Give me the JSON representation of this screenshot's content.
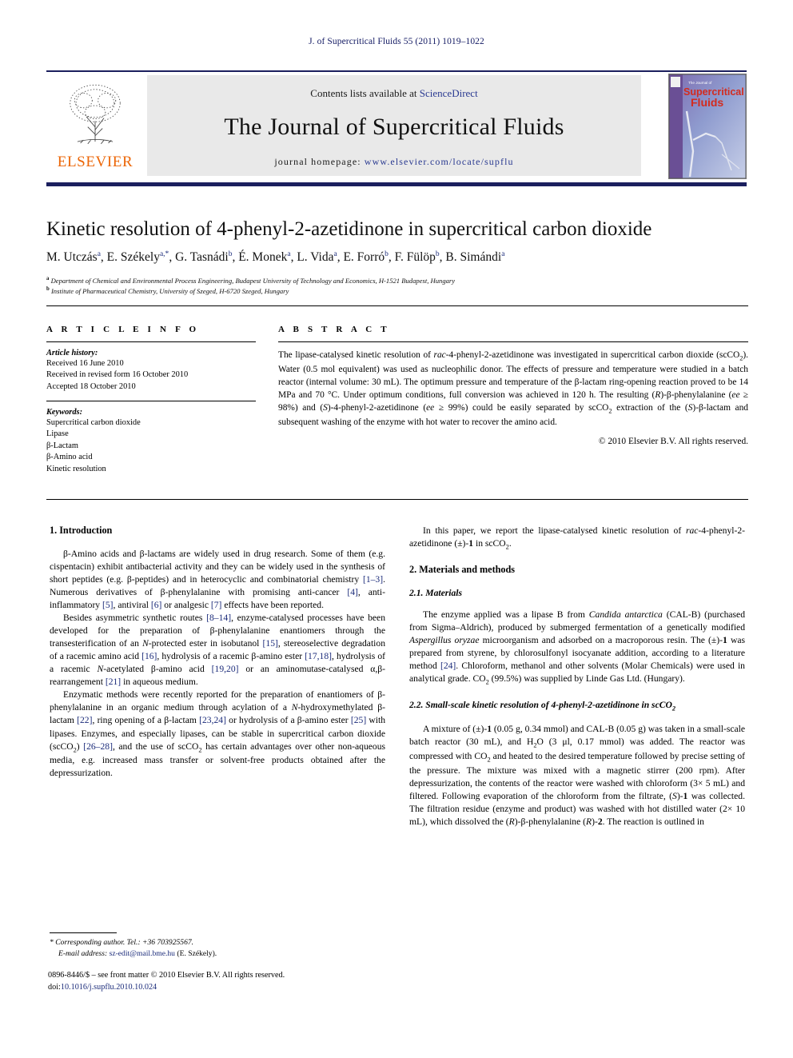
{
  "running_head": "J. of Supercritical Fluids 55 (2011) 1019–1022",
  "banner": {
    "publisher": "ELSEVIER",
    "contents_prefix": "Contents lists available at ",
    "contents_link": "ScienceDirect",
    "journal_title": "The Journal of Supercritical Fluids",
    "homepage_prefix": "journal homepage: ",
    "homepage_url": "www.elsevier.com/locate/supflu",
    "cover_line1": "The Journal of",
    "cover_line2": "Supercritical",
    "cover_line3": "Fluids",
    "accent_orange": "#ec6607",
    "accent_blue": "#2a3a91",
    "rule_navy": "#1b1f5e"
  },
  "article": {
    "title": "Kinetic resolution of 4-phenyl-2-azetidinone in supercritical carbon dioxide",
    "authors_html": "M. Utczás<sup>a</sup>, E. Székely<sup>a,*</sup>, G. Tasnádi<sup>b</sup>, É. Monek<sup>a</sup>, L. Vida<sup>a</sup>, E. Forró<sup>b</sup>, F. Fülöp<sup>b</sup>, B. Simándi<sup>a</sup>",
    "affiliation_a": "Department of Chemical and Environmental Process Engineering, Budapest University of Technology and Economics, H-1521 Budapest, Hungary",
    "affiliation_b": "Institute of Pharmaceutical Chemistry, University of Szeged, H-6720 Szeged, Hungary"
  },
  "info": {
    "heading": "A R T I C L E    I N F O",
    "history_label": "Article history:",
    "history": [
      "Received 16 June 2010",
      "Received in revised form 16 October 2010",
      "Accepted 18 October 2010"
    ],
    "keywords_label": "Keywords:",
    "keywords": [
      "Supercritical carbon dioxide",
      "Lipase",
      "β-Lactam",
      "β-Amino acid",
      "Kinetic resolution"
    ]
  },
  "abstract": {
    "heading": "A B S T R A C T",
    "text_html": "The lipase-catalysed kinetic resolution of <i>rac</i>-4-phenyl-2-azetidinone was investigated in supercritical carbon dioxide (scCO<sub>2</sub>). Water (0.5 mol equivalent) was used as nucleophilic donor. The effects of pressure and temperature were studied in a batch reactor (internal volume: 30 mL). The optimum pressure and temperature of the β-lactam ring-opening reaction proved to be 14 MPa and 70 °C. Under optimum conditions, full conversion was achieved in 120 h. The resulting (<i>R</i>)-β-phenylalanine (<i>ee</i> ≥ 98%) and (<i>S</i>)-4-phenyl-2-azetidinone (<i>ee</i> ≥ 99%) could be easily separated by scCO<sub>2</sub> extraction of the (<i>S</i>)-β-lactam and subsequent washing of the enzyme with hot water to recover the amino acid.",
    "copyright": "© 2010 Elsevier B.V. All rights reserved."
  },
  "body": {
    "left": {
      "section1_heading": "1.  Introduction",
      "p1_html": "β-Amino acids and β-lactams are widely used in drug research. Some of them (e.g. cispentacin) exhibit antibacterial activity and they can be widely used in the synthesis of short peptides (e.g. β-peptides) and in heterocyclic and combinatorial chemistry <span class=\"ref\">[1–3]</span>. Numerous derivatives of β-phenylalanine with promising anti-cancer <span class=\"ref\">[4]</span>, anti-inflammatory <span class=\"ref\">[5]</span>, antiviral <span class=\"ref\">[6]</span> or analgesic <span class=\"ref\">[7]</span> effects have been reported.",
      "p2_html": "Besides asymmetric synthetic routes <span class=\"ref\">[8–14]</span>, enzyme-catalysed processes have been developed for the preparation of β-phenylalanine enantiomers through the transesterification of an <i>N</i>-protected ester in isobutanol <span class=\"ref\">[15]</span>, stereoselective degradation of a racemic amino acid <span class=\"ref\">[16]</span>, hydrolysis of a racemic β-amino ester <span class=\"ref\">[17,18]</span>, hydrolysis of a racemic <i>N</i>-acetylated β-amino acid <span class=\"ref\">[19,20]</span> or an aminomutase-catalysed α,β-rearrangement <span class=\"ref\">[21]</span> in aqueous medium.",
      "p3_html": "Enzymatic methods were recently reported for the preparation of enantiomers of β-phenylalanine in an organic medium through acylation of a <i>N</i>-hydroxymethylated β-lactam <span class=\"ref\">[22]</span>, ring opening of a β-lactam <span class=\"ref\">[23,24]</span> or hydrolysis of a β-amino ester <span class=\"ref\">[25]</span> with lipases. Enzymes, and especially lipases, can be stable in supercritical carbon dioxide (scCO<sub>2</sub>) <span class=\"ref\">[26–28]</span>, and the use of scCO<sub>2</sub> has certain advantages over other non-aqueous media, e.g. increased mass transfer or solvent-free products obtained after the depressurization."
    },
    "right": {
      "p1_html": "In this paper, we report the lipase-catalysed kinetic resolution of <i>rac</i>-4-phenyl-2-azetidinone (±)-<b>1</b> in scCO<sub>2</sub>.",
      "section2_heading": "2.  Materials and methods",
      "subsection21_heading": "2.1.  Materials",
      "p2_html": "The enzyme applied was a lipase B from <i>Candida antarctica</i> (CAL-B) (purchased from Sigma–Aldrich), produced by submerged fermentation of a genetically modified <i>Aspergillus oryzae</i> microorganism and adsorbed on a macroporous resin. The (±)-<b>1</b> was prepared from styrene, by chlorosulfonyl isocyanate addition, according to a literature method <span class=\"ref\">[24]</span>. Chloroform, methanol and other solvents (Molar Chemicals) were used in analytical grade. CO<sub>2</sub> (99.5%) was supplied by Linde Gas Ltd. (Hungary).",
      "subsection22_heading_html": "2.2.  Small-scale kinetic resolution of 4-phenyl-2-azetidinone in scCO<sub>2</sub>",
      "p3_html": "A mixture of (±)-<b>1</b> (0.05 g, 0.34 mmol) and CAL-B (0.05 g) was taken in a small-scale batch reactor (30 mL), and H<sub>2</sub>O (3 μl, 0.17 mmol) was added. The reactor was compressed with CO<sub>2</sub> and heated to the desired temperature followed by precise setting of the pressure. The mixture was mixed with a magnetic stirrer (200 rpm). After depressurization, the contents of the reactor were washed with chloroform (3× 5 mL) and filtered. Following evaporation of the chloroform from the filtrate, (<i>S</i>)-<b>1</b> was collected. The filtration residue (enzyme and product) was washed with hot distilled water (2× 10 mL), which dissolved the (<i>R</i>)-β-phenylalanine (<i>R</i>)-<b>2</b>. The reaction is outlined in"
    }
  },
  "footnote": {
    "corresponding_html": "* <i>Corresponding author. Tel.: +36 703925567.</i>",
    "email_label": "E-mail address:",
    "email": "sz-edit@mail.bme.hu",
    "email_suffix": " (E. Székely)."
  },
  "imprint": {
    "front_matter": "0896-8446/$ – see front matter © 2010 Elsevier B.V. All rights reserved.",
    "doi_prefix": "doi:",
    "doi": "10.1016/j.supflu.2010.10.024"
  }
}
